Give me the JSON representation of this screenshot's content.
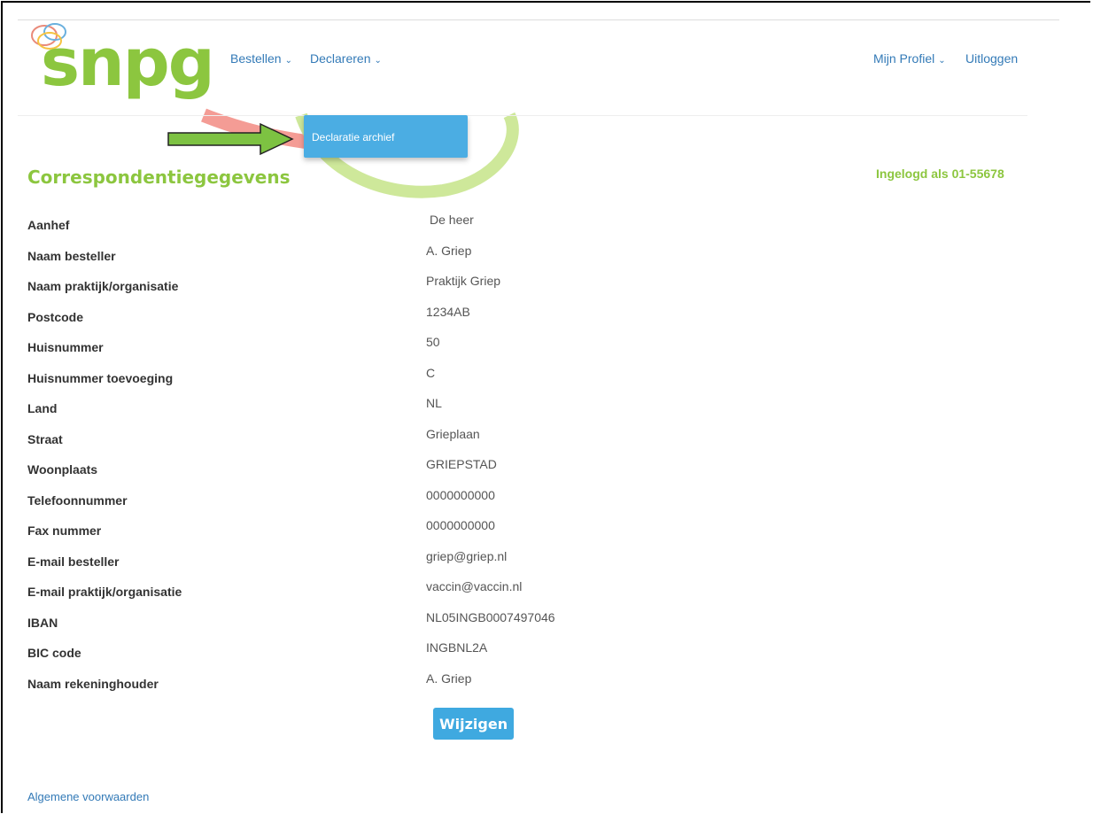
{
  "brand": {
    "logo_text": "snpg"
  },
  "nav": {
    "bestellen": "Bestellen",
    "declareren": "Declareren",
    "profiel": "Mijn Profiel",
    "uitloggen": "Uitloggen",
    "caret": "⌄"
  },
  "dropdown": {
    "item": "Declaratie archief"
  },
  "page": {
    "title": "Correspondentiegegevens",
    "logged_in": "Ingelogd als 01-55678"
  },
  "fields": [
    {
      "label": "Aanhef",
      "value": "De heer"
    },
    {
      "label": "Naam besteller",
      "value": "A. Griep"
    },
    {
      "label": "Naam praktijk/organisatie",
      "value": "Praktijk Griep"
    },
    {
      "label": "Postcode",
      "value": "1234AB"
    },
    {
      "label": "Huisnummer",
      "value": "50"
    },
    {
      "label": "Huisnummer toevoeging",
      "value": "C"
    },
    {
      "label": "Land",
      "value": "NL"
    },
    {
      "label": "Straat",
      "value": "Grieplaan"
    },
    {
      "label": "Woonplaats",
      "value": "GRIEPSTAD"
    },
    {
      "label": "Telefoonnummer",
      "value": "0000000000"
    },
    {
      "label": "Fax nummer",
      "value": "0000000000"
    },
    {
      "label": "E-mail besteller",
      "value": "griep@griep.nl"
    },
    {
      "label": "E-mail praktijk/organisatie",
      "value": "vaccin@vaccin.nl"
    },
    {
      "label": "IBAN",
      "value": "NL05INGB0007497046"
    },
    {
      "label": "BIC code",
      "value": "INGBNL2A"
    },
    {
      "label": "Naam rekeninghouder",
      "value": "A. Griep"
    }
  ],
  "actions": {
    "edit": "Wijzigen"
  },
  "footer": {
    "terms": "Algemene voorwaarden"
  },
  "colors": {
    "brand_green": "#8cc63f",
    "link_blue": "#337ab7",
    "button_blue": "#3fa9e0",
    "arrow_green": "#7dc242"
  },
  "icons": {
    "arrow": "right-arrow-icon",
    "caret": "chevron-down-icon"
  }
}
